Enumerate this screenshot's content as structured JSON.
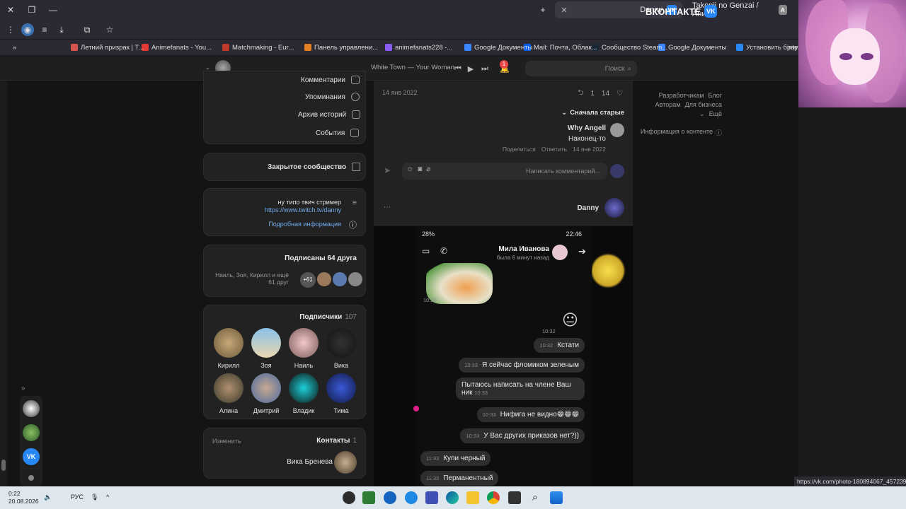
{
  "tabs": [
    {
      "label": "Danny",
      "active": true
    },
    {
      "label": "Takopii no Genzai / Аниме",
      "active": false
    }
  ],
  "bookmarks": [
    "Установить браузер",
    "Google Документы",
    "Сообщество Steam...",
    "Mail: Почта, Облак...",
    "Google Документы",
    "animefanats228 -...",
    "Панель управлени...",
    "Matchmaking - Eur...",
    "Animefanats - You...",
    "Летний призрак | T...",
    "interest"
  ],
  "header": {
    "logo": "ВКОНТАКТЕ",
    "search_placeholder": "Поиск",
    "player_track": "White Town — Your Woman",
    "notifications_badge": "1"
  },
  "right_menu": {
    "links": [
      "Блог",
      "Разработчикам",
      "Для бизнеса",
      "Авторам",
      "Ещё"
    ],
    "content_info": "Информация о контенте"
  },
  "profile_menu": {
    "items": [
      "Комментарии",
      "Упоминания",
      "Архив историй",
      "События"
    ]
  },
  "closed_community": "Закрытое сообщество",
  "about": {
    "status": "ну типо твич стример",
    "link": "https://www.twitch.tv/danny",
    "more": "Подробная информация"
  },
  "subscribed_friends": {
    "title": "Подписаны 64 друга",
    "text": "Наиль, Зоя, Кирилл и ещё 61 друг",
    "more_badge": "+61"
  },
  "followers": {
    "title": "Подписчики",
    "count": "107",
    "people": [
      "Вика",
      "Наиль",
      "Зоя",
      "Кирилл",
      "Тима",
      "Владик",
      "Дмитрий",
      "Алина"
    ]
  },
  "contacts": {
    "title": "Контакты",
    "count": "1",
    "edit": "Изменить",
    "name": "Вика Бренева"
  },
  "post": {
    "likes": "14",
    "reposts": "1",
    "date": "14 янв 2022",
    "sort": "Сначала старые",
    "comment": {
      "author": "Why Angell",
      "text": "Наконец-то",
      "date": "14 янв 2022",
      "reply": "Ответить",
      "share": "Поделиться"
    },
    "comment_placeholder": "Написать комментарий...",
    "footer_author": "Danny"
  },
  "chat": {
    "status_time": "22:46",
    "battery": "28%",
    "contact_name": "Мила Иванова",
    "last_seen": "была 6 минут назад",
    "messages": [
      {
        "text": "",
        "time": "10:20"
      },
      {
        "text": "😐",
        "time": "10:32"
      },
      {
        "text": "Кстати",
        "time": "10:32"
      },
      {
        "text": "Я сейчас фломиком зеленым",
        "time": "10:33"
      },
      {
        "text": "Пытаюсь написать на члене Ваш ник",
        "time": "10:33"
      },
      {
        "text": "Нифига не видно😁😁😁",
        "time": "10:33"
      },
      {
        "text": "У Вас других приказов нет?))",
        "time": "10:33"
      },
      {
        "text": "Купи черный",
        "time": "11:33"
      },
      {
        "text": "Перманентный",
        "time": "11:33"
      }
    ]
  },
  "status_url": "https://vk.com/photo-180894067_457239645",
  "taskbar": {
    "time": "0:22",
    "date": "20.08.2026",
    "lang": "РУС"
  },
  "colors": {
    "accent": "#2787f5",
    "page_bg": "#141414",
    "card_bg": "#222222"
  }
}
